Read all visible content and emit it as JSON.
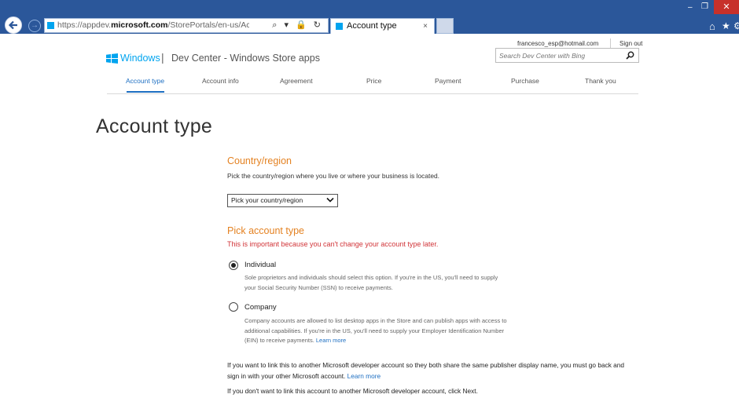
{
  "browser": {
    "url_prefix": "https://appdev.",
    "url_domain": "microsoft.com",
    "url_path": "/StorePortals/en-us/Account/Signup/SelectAccou",
    "tab_title": "Account type",
    "tab_close": "×",
    "addr_icons": "⌕ ▾ 🔒 ↻",
    "min_glyph": "–",
    "max_glyph": "❐",
    "close_glyph": "✕",
    "forward_glyph": "→",
    "home_glyph": "⌂",
    "star_glyph": "★",
    "gear_glyph": "⚙"
  },
  "header": {
    "user_email": "francesco_esp@hotmail.com",
    "sign_out": "Sign out",
    "logo_text": "Windows",
    "separator": "|",
    "site_title": "Dev Center - Windows Store apps",
    "search_placeholder": "Search Dev Center with Bing"
  },
  "steps": [
    {
      "label": "Account type",
      "active": true
    },
    {
      "label": "Account info",
      "active": false
    },
    {
      "label": "Agreement",
      "active": false
    },
    {
      "label": "Price",
      "active": false
    },
    {
      "label": "Payment",
      "active": false
    },
    {
      "label": "Purchase",
      "active": false
    },
    {
      "label": "Thank you",
      "active": false
    }
  ],
  "page": {
    "title": "Account type",
    "country": {
      "heading": "Country/region",
      "help": "Pick the country/region where you live or where your business is located.",
      "select_value": "Pick your country/region"
    },
    "account_type": {
      "heading": "Pick account type",
      "warning": "This is important because you can't change your account type later.",
      "options": [
        {
          "label": "Individual",
          "selected": true,
          "desc": "Sole proprietors and individuals should select this option. If you're in the US, you'll need to supply your Social Security Number (SSN) to receive payments."
        },
        {
          "label": "Company",
          "selected": false,
          "desc": "Company accounts are allowed to list desktop apps in the Store and can publish apps with access to additional capabilities. If you're in the US, you'll need to supply your Employer Identification Number (EIN) to receive payments.",
          "link": "Learn more"
        }
      ]
    },
    "note_link": {
      "text": "If you want to link this to another Microsoft developer account so they both share the same publisher display name, you must go back and sign in with your other Microsoft account.",
      "link": "Learn more"
    },
    "note_next": "If you don't want to link this account to another Microsoft developer account, click Next."
  },
  "colors": {
    "chrome": "#2b579a",
    "accent": "#1e6fc2",
    "section_heading": "#e48222",
    "warning": "#d13438",
    "windows_blue": "#00a4ef"
  }
}
